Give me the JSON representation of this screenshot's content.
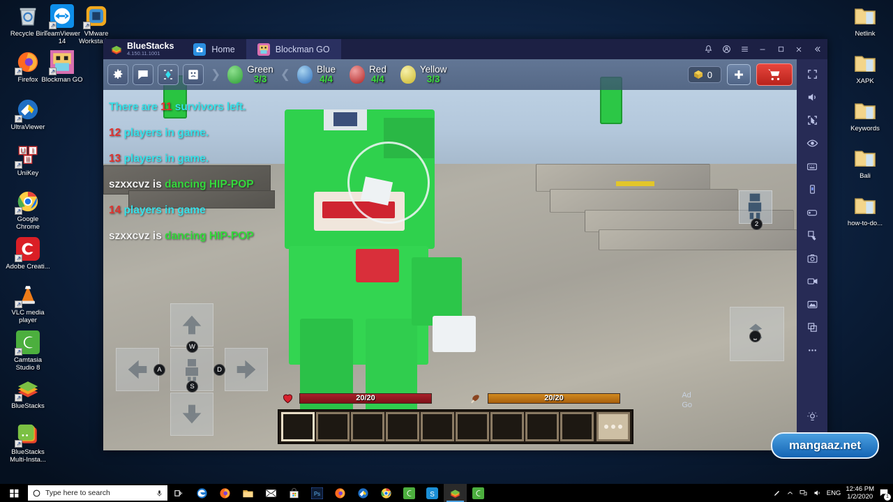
{
  "desktop": {
    "icons_left": [
      {
        "label": "Recycle Bin",
        "icon": "recycle-bin-icon",
        "shortcut": false
      },
      {
        "label": "TeamViewer 14",
        "icon": "teamviewer-icon",
        "shortcut": true
      },
      {
        "label": "VMware Workstation",
        "icon": "vmware-icon",
        "shortcut": true
      },
      {
        "label": "Firefox",
        "icon": "firefox-icon",
        "shortcut": true
      },
      {
        "label": "Blockman GO",
        "icon": "blockman-go-icon",
        "shortcut": true
      },
      {
        "label": "UltraViewer",
        "icon": "ultraviewer-icon",
        "shortcut": true
      },
      {
        "label": "UniKey",
        "icon": "unikey-icon",
        "shortcut": true
      },
      {
        "label": "Google Chrome",
        "icon": "chrome-icon",
        "shortcut": true
      },
      {
        "label": "Adobe Creati...",
        "icon": "adobe-cc-icon",
        "shortcut": true
      },
      {
        "label": "VLC media player",
        "icon": "vlc-icon",
        "shortcut": true
      },
      {
        "label": "Camtasia Studio 8",
        "icon": "camtasia-icon",
        "shortcut": true
      },
      {
        "label": "BlueStacks",
        "icon": "bluestacks-icon",
        "shortcut": true
      },
      {
        "label": "BlueStacks Multi-Insta...",
        "icon": "bluestacks-multi-icon",
        "shortcut": true
      }
    ],
    "icons_right": [
      {
        "label": "Netlink",
        "icon": "folder-icon"
      },
      {
        "label": "XAPK",
        "icon": "folder-icon"
      },
      {
        "label": "Keywords",
        "icon": "folder-icon"
      },
      {
        "label": "Bali",
        "icon": "folder-icon"
      },
      {
        "label": "how-to-do...",
        "icon": "folder-icon"
      }
    ]
  },
  "taskbar": {
    "start_label": "start-button",
    "search_placeholder": "Type here to search",
    "cortana_icon": "cortana-circle-icon",
    "mic_icon": "microphone-icon",
    "taskview_icon": "task-view-icon",
    "apps": [
      {
        "name": "edge-icon"
      },
      {
        "name": "firefox-icon"
      },
      {
        "name": "file-explorer-icon"
      },
      {
        "name": "mail-icon"
      },
      {
        "name": "microsoft-store-icon"
      },
      {
        "name": "photoshop-icon"
      },
      {
        "name": "firefox-icon"
      },
      {
        "name": "ultraviewer-icon"
      },
      {
        "name": "chrome-icon"
      },
      {
        "name": "camtasia-icon"
      },
      {
        "name": "skype-icon"
      },
      {
        "name": "bluestacks-icon"
      },
      {
        "name": "camtasia-icon"
      }
    ],
    "tray": {
      "pen_icon": "pen-icon",
      "chevron_icon": "show-hidden-icons-icon",
      "network_icon": "network-icon",
      "volume_icon": "volume-icon",
      "language": "ENG",
      "time": "12:46 PM",
      "date": "1/2/2020",
      "notifications_icon": "action-center-icon",
      "notification_count": "1"
    }
  },
  "bluestacks": {
    "brand": "BlueStacks",
    "version": "4.150.11.1001",
    "logo_icon": "bluestacks-logo-icon",
    "tabs": [
      {
        "label": "Home",
        "icon": "home-app-icon",
        "selected": false
      },
      {
        "label": "Blockman GO",
        "icon": "blockman-go-icon",
        "selected": true
      }
    ],
    "window_controls": [
      {
        "name": "notifications-bell-icon",
        "glyph": "⊗"
      },
      {
        "name": "profile-icon",
        "glyph": "◎"
      },
      {
        "name": "menu-icon",
        "glyph": "☰"
      },
      {
        "name": "minimize-button",
        "glyph": "─"
      },
      {
        "name": "maximize-button",
        "glyph": "□"
      },
      {
        "name": "close-button",
        "glyph": "✕"
      },
      {
        "name": "collapse-sidebar-button",
        "glyph": "«"
      }
    ],
    "sidebar": [
      {
        "name": "fullscreen-icon"
      },
      {
        "name": "volume-icon"
      },
      {
        "name": "focus-mode-icon"
      },
      {
        "name": "eye-icon"
      },
      {
        "name": "keyboard-controls-icon"
      },
      {
        "name": "phone-rotate-icon"
      },
      {
        "name": "gamepad-icon"
      },
      {
        "name": "macro-recorder-icon"
      },
      {
        "name": "screenshot-camera-icon"
      },
      {
        "name": "screen-record-icon"
      },
      {
        "name": "media-manager-icon"
      },
      {
        "name": "multi-instance-icon"
      },
      {
        "name": "more-options-icon"
      },
      {
        "name": "brightness-icon"
      },
      {
        "name": "settings-gear-icon"
      }
    ]
  },
  "game": {
    "hud_buttons": [
      {
        "name": "settings-gear-button",
        "glyph": "gear"
      },
      {
        "name": "chat-button",
        "glyph": "chat"
      },
      {
        "name": "target-button",
        "glyph": "target"
      },
      {
        "name": "emoji-button",
        "glyph": "emoji"
      }
    ],
    "teams": [
      {
        "name": "Green",
        "count": "3/3",
        "color": "#3fc23f"
      },
      {
        "name": "Blue",
        "count": "4/4",
        "color": "#3f7fd8"
      },
      {
        "name": "Red",
        "count": "4/4",
        "color": "#d33b3b"
      },
      {
        "name": "Yellow",
        "count": "3/3",
        "color": "#e3d44a"
      }
    ],
    "currency": {
      "icon": "gold-cube-icon",
      "value": "0"
    },
    "plus_button_label": "+",
    "cart_button_icon": "shopping-cart-icon",
    "chat_messages": [
      {
        "parts": [
          {
            "t": "There are ",
            "c": "c-cyan"
          },
          {
            "t": "11",
            "c": "c-red"
          },
          {
            "t": " survivors left.",
            "c": "c-cyan"
          }
        ]
      },
      {
        "parts": [
          {
            "t": "12",
            "c": "c-red"
          },
          {
            "t": " players in game.",
            "c": "c-cyan"
          }
        ]
      },
      {
        "parts": [
          {
            "t": "13",
            "c": "c-red"
          },
          {
            "t": " players in game.",
            "c": "c-cyan"
          }
        ]
      },
      {
        "parts": [
          {
            "t": "szxxcvz is ",
            "c": "c-white"
          },
          {
            "t": "dancing HIP-POP",
            "c": "c-green"
          }
        ]
      },
      {
        "parts": [
          {
            "t": "14",
            "c": "c-red"
          },
          {
            "t": " players in game",
            "c": "c-cyan"
          }
        ]
      },
      {
        "parts": [
          {
            "t": "szxxcvz is ",
            "c": "c-white"
          },
          {
            "t": "dancing HIP-POP",
            "c": "c-green"
          }
        ]
      }
    ],
    "dpad": [
      {
        "name": "move-forward-button",
        "key": "W",
        "dir": "up"
      },
      {
        "name": "move-left-button",
        "key": "A",
        "dir": "left"
      },
      {
        "name": "move-right-button",
        "key": "D",
        "dir": "right"
      },
      {
        "name": "move-back-button",
        "key": "S",
        "dir": "down"
      },
      {
        "name": "center-avatar-button",
        "key": "",
        "dir": "center"
      }
    ],
    "avatar_button": {
      "name": "character-button",
      "key": "2"
    },
    "jump_button": {
      "name": "jump-button",
      "key": "␣"
    },
    "health": {
      "icon": "heart-icon",
      "value": "20/20",
      "color": "#a8202a"
    },
    "hunger": {
      "icon": "meat-icon",
      "value": "20/20",
      "color": "#c87a18"
    },
    "hotbar": {
      "slots": 9,
      "selected_index": 0,
      "more_label": "more-slots-button"
    }
  },
  "watermark": {
    "text": "mangaaz.net"
  },
  "ad_text": {
    "line1": "Ad",
    "line2": "Go"
  }
}
